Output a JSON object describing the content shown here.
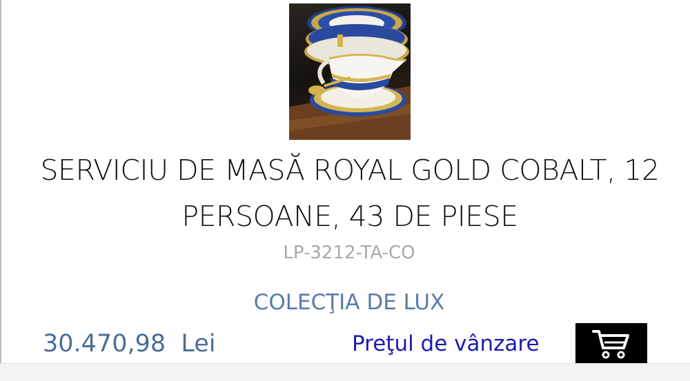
{
  "product": {
    "image_alt": "Serviciu de masă Royal Gold Cobalt",
    "title": "SERVICIU DE MASĂ ROYAL GOLD COBALT, 12 PERSOANE, 43 DE PIESE",
    "sku": "LP-3212-TA-CO",
    "collection": "COLECŢIA DE LUX",
    "price": "30.470,98  Lei",
    "price_label": "Preţul de vânzare"
  },
  "cart": {
    "icon": "shopping-cart-icon"
  },
  "colors": {
    "title": "#111111",
    "sku": "#a9a9a9",
    "collection": "#5a7ca8",
    "price": "#4a6d96",
    "price_label": "#1b1bb0",
    "cart_bg": "#000000"
  }
}
